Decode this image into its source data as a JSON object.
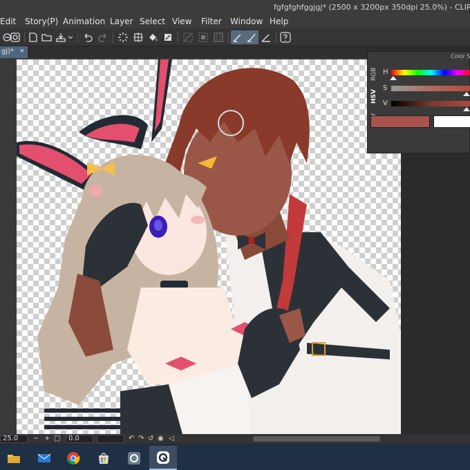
{
  "window": {
    "title": "fgfgfghfggjgj* (2500 x 3200px 350dpi 25.0%)  - CLIP STUDIO P"
  },
  "menu": {
    "items": [
      "Edit",
      "Story(P)",
      "Animation",
      "Layer",
      "Select",
      "View",
      "Filter",
      "Window",
      "Help"
    ]
  },
  "document_tab": {
    "label": "gj)*",
    "close": "×"
  },
  "color_panel": {
    "title": "Color Sli",
    "modes": [
      "RGB",
      "HSV",
      "CMY"
    ],
    "active_mode": "HSV",
    "sliders": [
      {
        "label": "H",
        "value": 0.03
      },
      {
        "label": "S",
        "value": 0.95
      },
      {
        "label": "V",
        "value": 0.98
      }
    ],
    "main_color": "#a8544d",
    "sub_color": "#ffffff"
  },
  "status": {
    "zoom": "25.0",
    "minus": "−",
    "plus": "+",
    "angle": "0.0"
  },
  "icons": {
    "toolbar": [
      "new-file-icon",
      "open-icon",
      "save-icon",
      "undo-icon",
      "redo-icon",
      "deselect-icon",
      "fill-icon",
      "pen-icon"
    ],
    "taskbar": [
      "file-explorer-icon",
      "mail-icon",
      "chrome-icon",
      "store-icon",
      "clip-studio-icon",
      "clip-studio-paint-icon"
    ]
  },
  "colors": {
    "accent": "#4e6680",
    "titlebar": "#3c3c3c",
    "taskbar": "#1f2f44"
  }
}
